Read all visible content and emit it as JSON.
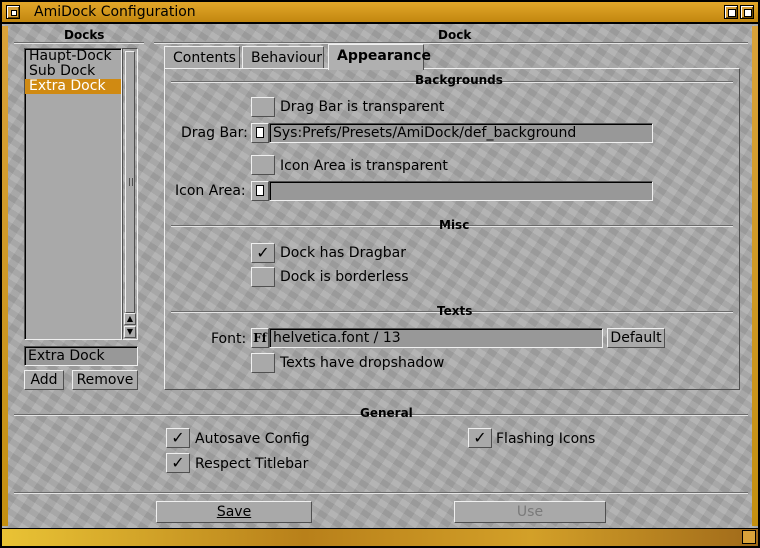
{
  "window": {
    "title": "AmiDock Configuration"
  },
  "docks": {
    "group_label": "Docks",
    "items": [
      {
        "label": "Haupt-Dock"
      },
      {
        "label": "Sub Dock"
      },
      {
        "label": "Extra Dock"
      }
    ],
    "selected": "Extra Dock",
    "name_field_value": "Extra Dock",
    "add_label": "Add",
    "remove_label": "Remove"
  },
  "dock": {
    "group_label": "Dock",
    "tabs": [
      {
        "label": "Contents"
      },
      {
        "label": "Behaviour"
      },
      {
        "label": "Appearance"
      }
    ],
    "active_tab": "Appearance",
    "backgrounds": {
      "group_label": "Backgrounds",
      "dragbar_transparent_label": "Drag Bar is transparent",
      "dragbar_transparent_checked": false,
      "dragbar_field_label": "Drag Bar:",
      "dragbar_field_value": "Sys:Prefs/Presets/AmiDock/def_background",
      "iconarea_transparent_label": "Icon Area is transparent",
      "iconarea_transparent_checked": false,
      "iconarea_field_label": "Icon Area:",
      "iconarea_field_value": ""
    },
    "misc": {
      "group_label": "Misc",
      "has_dragbar_label": "Dock has Dragbar",
      "has_dragbar_checked": true,
      "borderless_label": "Dock is borderless",
      "borderless_checked": false
    },
    "texts": {
      "group_label": "Texts",
      "font_label": "Font:",
      "font_value": "helvetica.font / 13",
      "default_label": "Default",
      "dropshadow_label": "Texts have dropshadow",
      "dropshadow_checked": false
    }
  },
  "general": {
    "group_label": "General",
    "autosave_label": "Autosave Config",
    "autosave_checked": true,
    "respect_titlebar_label": "Respect Titlebar",
    "respect_titlebar_checked": true,
    "flashing_icons_label": "Flashing Icons",
    "flashing_icons_checked": true
  },
  "footer": {
    "save_label": "Save",
    "use_label": "Use"
  },
  "icons": {
    "checkmark": "✓",
    "getfile": "file-icon",
    "getfont": "font-icon"
  }
}
